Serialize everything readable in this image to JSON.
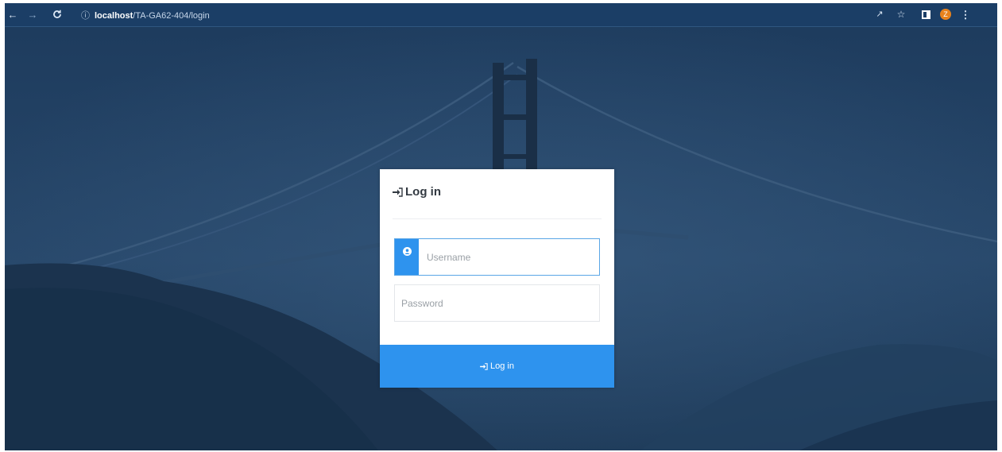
{
  "browser": {
    "url_host": "localhost",
    "url_path": "/TA-GA62-404/login",
    "profile_initial": "Z"
  },
  "login": {
    "title": "Log in",
    "username_placeholder": "Username",
    "password_placeholder": "Password",
    "submit_label": "Log in",
    "accent_color": "#2e93ee"
  }
}
